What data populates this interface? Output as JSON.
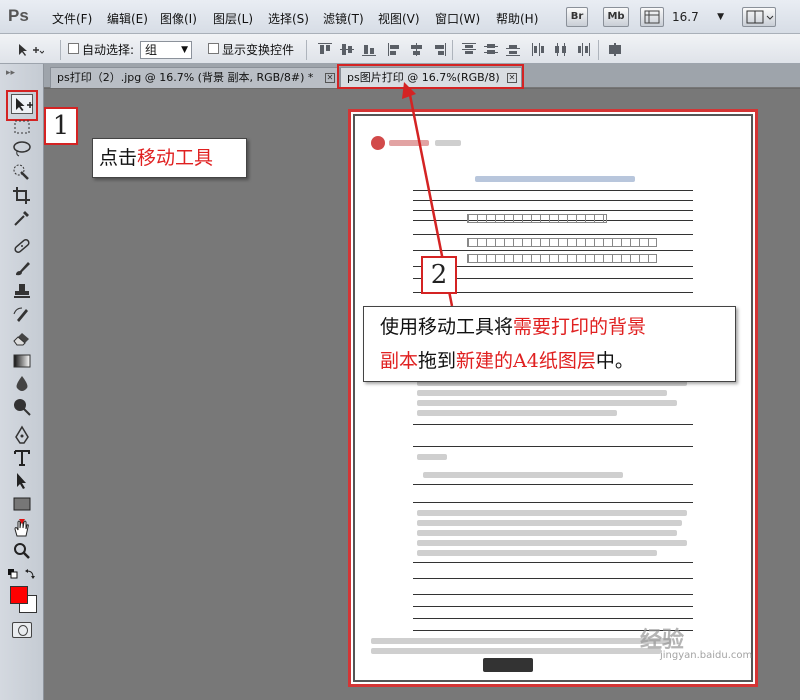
{
  "app": {
    "logo": "Ps"
  },
  "menu": [
    "文件(F)",
    "编辑(E)",
    "图像(I)",
    "图层(L)",
    "选择(S)",
    "滤镜(T)",
    "视图(V)",
    "窗口(W)",
    "帮助(H)"
  ],
  "app_buttons": [
    "Br",
    "Mb"
  ],
  "zoom": "16.7",
  "options": {
    "auto_select_label": "自动选择:",
    "auto_select_value": "组",
    "show_transform_label": "显示变换控件"
  },
  "tabs": [
    {
      "label": "ps打印（2）.jpg @ 16.7% (背景 副本, RGB/8#) *"
    },
    {
      "label": "ps图片打印 @ 16.7%(RGB/8)"
    }
  ],
  "annotations": {
    "step1_number": "1",
    "step2_number": "2",
    "callout1": {
      "prefix": "点击",
      "highlight": "移动工具"
    },
    "callout2": {
      "line1_prefix": "使用移动工具将",
      "line1_highlight": "需要打印的背景",
      "line2_highlight1": "副本",
      "line2_mid": "拖到",
      "line2_highlight2": "新建的A4纸图层",
      "line2_suffix": "中。"
    }
  },
  "watermark": {
    "main": "经验",
    "sub": "jingyan.baidu.com"
  },
  "colors": {
    "foreground": "#ff0000",
    "background": "#ffffff",
    "annotation_red": "#d42323"
  }
}
